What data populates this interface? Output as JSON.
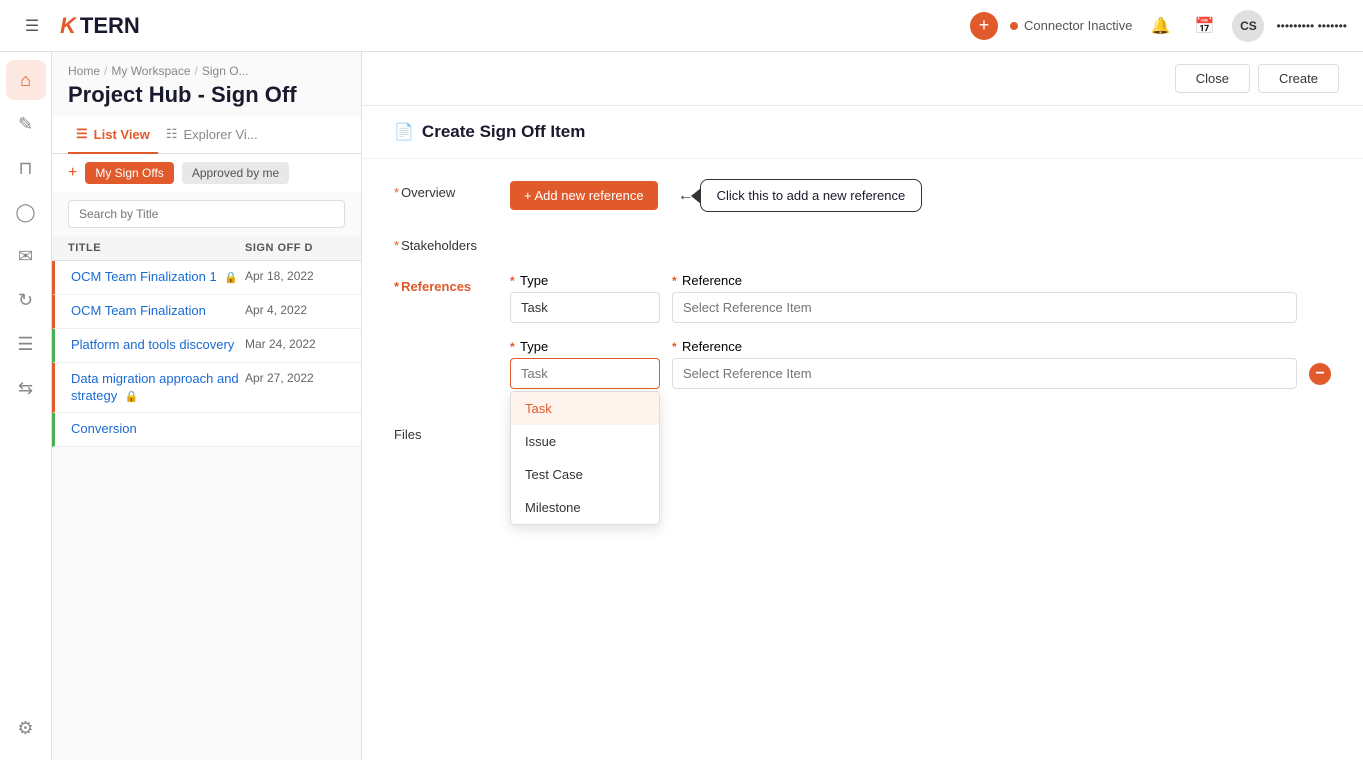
{
  "navbar": {
    "logo_k": "K",
    "logo_tern": "TERN",
    "connector_label": "Connector Inactive",
    "plus_btn_label": "+",
    "user_initials": "CS",
    "user_name": "••••••••• •••••••"
  },
  "breadcrumb": {
    "home": "Home",
    "workspace": "My Workspace",
    "current": "Sign O..."
  },
  "page": {
    "title": "Project Hub - Sign Off"
  },
  "view_tabs": [
    {
      "label": "List View",
      "icon": "list",
      "active": true
    },
    {
      "label": "Explorer Vi...",
      "icon": "grid",
      "active": false
    }
  ],
  "filters": [
    {
      "label": "My Sign Offs",
      "type": "orange"
    },
    {
      "label": "Approved by me",
      "type": "gray"
    }
  ],
  "search": {
    "placeholder": "Search by Title"
  },
  "table": {
    "columns": [
      "Title",
      "Sign Off D"
    ],
    "rows": [
      {
        "title": "OCM Team Finalization 1",
        "date": "Apr 18, 2022",
        "color": "orange",
        "locked": true
      },
      {
        "title": "OCM Team Finalization",
        "date": "Apr 4, 2022",
        "color": "orange",
        "locked": false
      },
      {
        "title": "Platform and tools discovery",
        "date": "Mar 24, 2022",
        "color": "green",
        "locked": false
      },
      {
        "title": "Data migration approach and strategy",
        "date": "Apr 27, 2022",
        "color": "orange",
        "locked": true
      },
      {
        "title": "Conversion",
        "date": "",
        "color": "green",
        "locked": false
      }
    ]
  },
  "form": {
    "title": "Create Sign Off Item",
    "title_icon": "📄",
    "close_label": "Close",
    "create_label": "Create",
    "fields": [
      {
        "key": "overview",
        "label": "Overview",
        "required": true
      },
      {
        "key": "stakeholders",
        "label": "Stakeholders",
        "required": true
      },
      {
        "key": "references",
        "label": "References",
        "required": true
      },
      {
        "key": "files",
        "label": "Files",
        "required": false
      }
    ],
    "add_ref_label": "+ Add new reference",
    "tooltip_text": "Click this to add a new reference",
    "ref_row1": {
      "type_label": "Type",
      "ref_label": "Reference",
      "type_value": "Task",
      "ref_placeholder": "Select Reference Item",
      "required": true
    },
    "ref_row2": {
      "type_label": "Type",
      "ref_label": "Reference",
      "type_placeholder": "Task",
      "ref_placeholder": "Select Reference Item",
      "required": true
    },
    "dropdown_options": [
      "Task",
      "Issue",
      "Test Case",
      "Milestone"
    ]
  }
}
